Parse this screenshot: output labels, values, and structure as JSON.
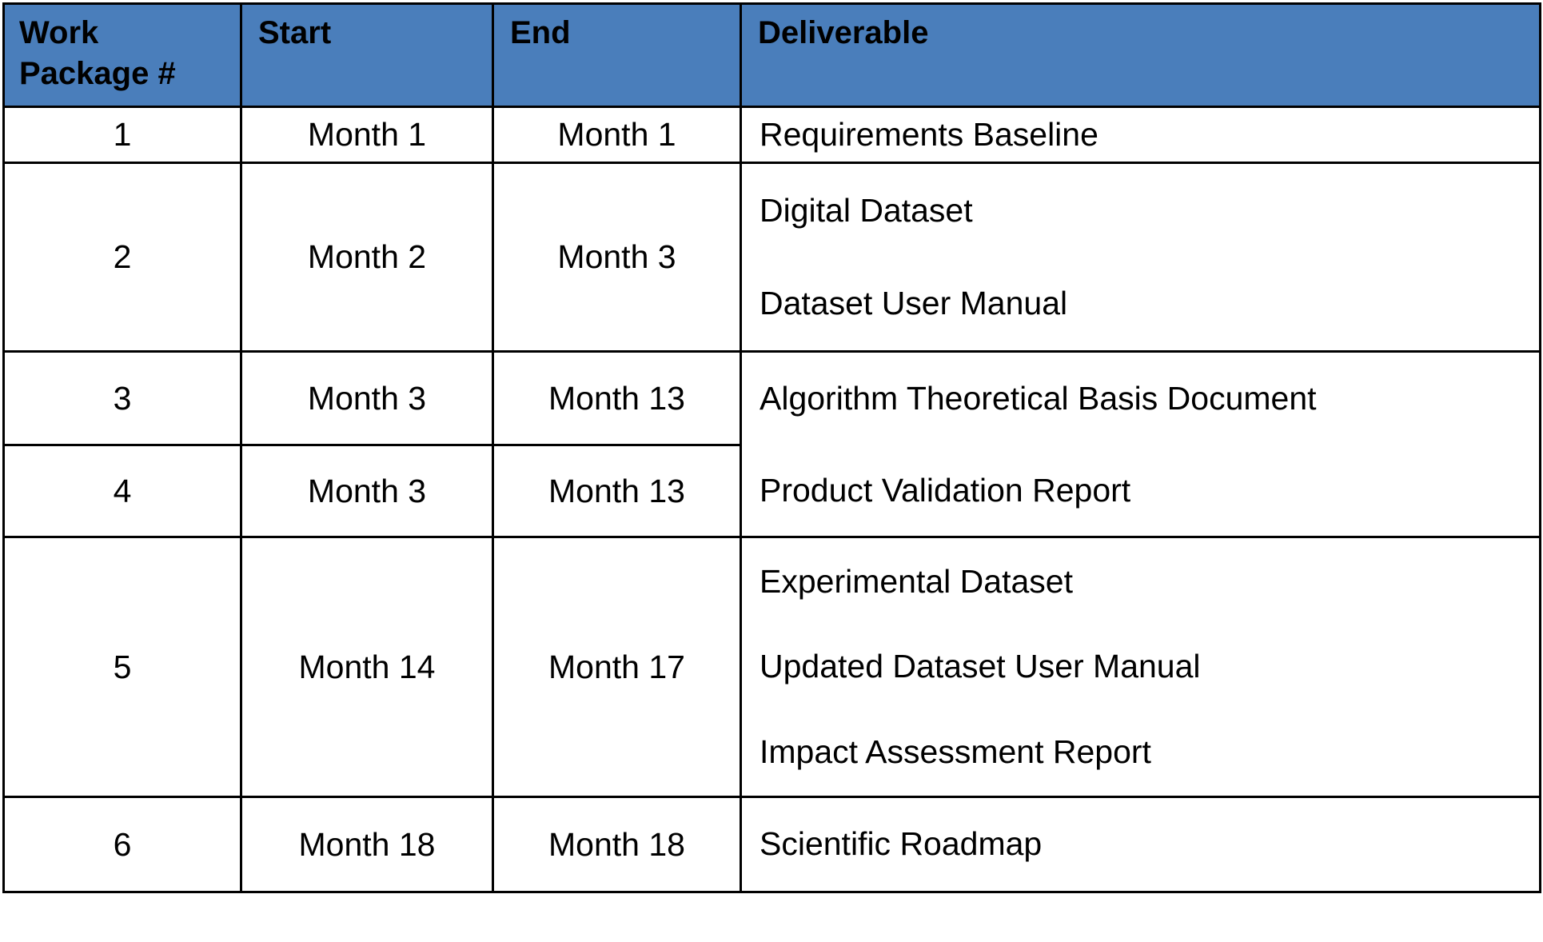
{
  "table": {
    "accent_header_color": "#4A7EBB",
    "border_color": "#000000",
    "background_color": "#FFFFFF",
    "columns": [
      {
        "key": "work_package",
        "label": "Work Package #"
      },
      {
        "key": "start",
        "label": "Start"
      },
      {
        "key": "end",
        "label": "End"
      },
      {
        "key": "deliverable",
        "label": "Deliverable"
      }
    ],
    "header": {
      "work_package_line1": "Work",
      "work_package_line2": "Package #",
      "start": "Start",
      "end": "End",
      "deliverable": "Deliverable"
    },
    "rows": [
      {
        "work_package": "1",
        "start": "Month 1",
        "end": "Month 1",
        "deliverables": [
          "Requirements Baseline"
        ]
      },
      {
        "work_package": "2",
        "start": "Month 2",
        "end": "Month 3",
        "deliverables": [
          "Digital Dataset",
          "Dataset User Manual"
        ]
      },
      {
        "work_package": "3",
        "start": "Month 3",
        "end": "Month 13",
        "deliverables": [
          "Algorithm Theoretical Basis Document"
        ]
      },
      {
        "work_package": "4",
        "start": "Month 3",
        "end": "Month 13",
        "deliverables": [
          "Product Validation Report"
        ]
      },
      {
        "work_package": "5",
        "start": "Month 14",
        "end": "Month 17",
        "deliverables": [
          "Experimental Dataset",
          "Updated Dataset User Manual",
          "Impact Assessment Report"
        ]
      },
      {
        "work_package": "6",
        "start": "Month 18",
        "end": "Month 18",
        "deliverables": [
          "Scientific Roadmap"
        ]
      }
    ]
  }
}
